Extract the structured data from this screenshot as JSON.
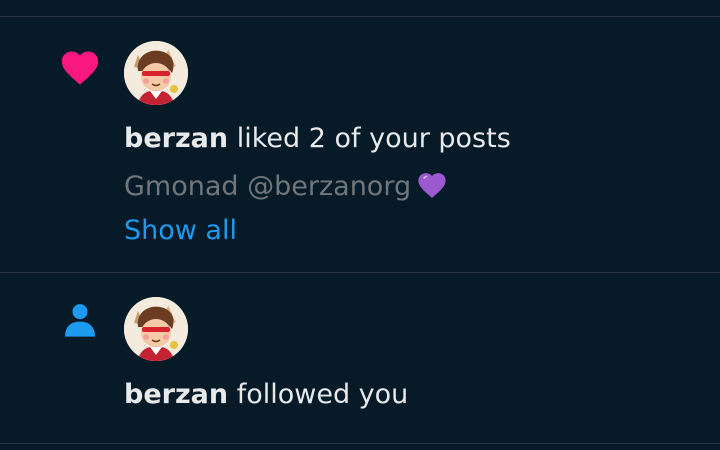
{
  "colors": {
    "background": "#061a28",
    "divider": "#253341",
    "primary_text": "#e7e9ea",
    "secondary_text": "#71767b",
    "like_pink": "#f91880",
    "follow_blue": "#1d9bf0",
    "purple_heart": "#9b59d0"
  },
  "notifications": [
    {
      "type_icon": "heart-icon",
      "avatar": "berzan-avatar",
      "user": "berzan",
      "action": " liked 2 of your posts",
      "quoted": "Gmonad @berzanorg",
      "quoted_emoji": "purple-heart-icon",
      "show_all_label": "Show all"
    },
    {
      "type_icon": "person-icon",
      "avatar": "berzan-avatar",
      "user": "berzan",
      "action": " followed you"
    }
  ]
}
